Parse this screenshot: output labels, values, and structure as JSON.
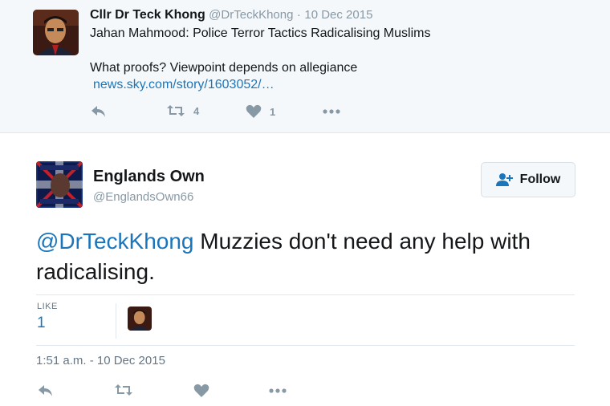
{
  "parent_tweet": {
    "display_name": "Cllr Dr Teck Khong",
    "handle": "@DrTeckKhong",
    "separator": "·",
    "date": "10 Dec 2015",
    "line1": "Jahan Mahmood: Police Terror Tactics Radicalising Muslims",
    "line2": "What proofs? Viewpoint depends on allegiance",
    "link": "news.sky.com/story/1603052/…",
    "retweet_count": "4",
    "like_count": "1"
  },
  "main_tweet": {
    "display_name": "Englands Own",
    "handle": "@EnglandsOwn66",
    "follow_label": "Follow",
    "mention": "@DrTeckKhong",
    "text": " Muzzies don't need any help with radicalising.",
    "like_label": "LIKE",
    "like_count": "1",
    "timestamp": "1:51 a.m. - 10 Dec 2015"
  },
  "colors": {
    "link_blue": "#1b75bb",
    "muted_grey": "#8899a6",
    "parent_bg": "#f5f8fa"
  },
  "icons": [
    "reply-icon",
    "retweet-icon",
    "heart-icon",
    "more-icon",
    "add-user-icon"
  ]
}
